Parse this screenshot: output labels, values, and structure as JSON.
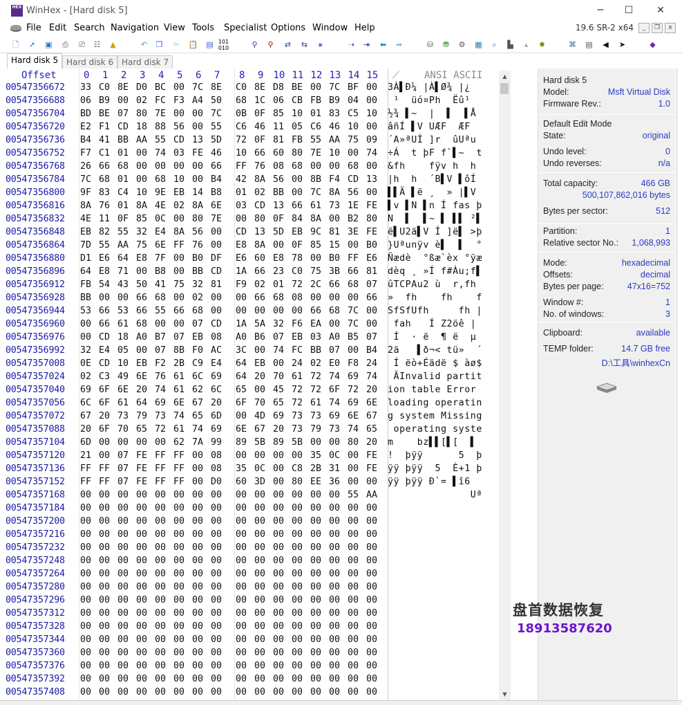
{
  "window": {
    "title": "WinHex - [Hard disk 5]",
    "app_icon_text": "HEX",
    "minimize": "─",
    "maximize": "☐",
    "close": "✕"
  },
  "menu": {
    "items": [
      "File",
      "Edit",
      "Search",
      "Navigation",
      "View",
      "Tools",
      "Specialist",
      "Options",
      "Window",
      "Help"
    ],
    "version": "19.6 SR-2 x64"
  },
  "tabs": [
    "Hard disk 5",
    "Hard disk 6",
    "Hard disk 7"
  ],
  "hex": {
    "offset_header": "Offset",
    "column_headers": [
      "0",
      "1",
      "2",
      "3",
      "4",
      "5",
      "6",
      "7",
      "8",
      "9",
      "10",
      "11",
      "12",
      "13",
      "14",
      "15"
    ],
    "ascii_header": "ANSI ASCII",
    "rows": [
      {
        "offset": "00547356672",
        "bytes": [
          "33",
          "C0",
          "8E",
          "D0",
          "BC",
          "00",
          "7C",
          "8E",
          "C0",
          "8E",
          "D8",
          "BE",
          "00",
          "7C",
          "BF",
          "00"
        ],
        "ascii": "3À▌Ð¼ |À▌Ø¾ |¿"
      },
      {
        "offset": "00547356688",
        "bytes": [
          "06",
          "B9",
          "00",
          "02",
          "FC",
          "F3",
          "A4",
          "50",
          "68",
          "1C",
          "06",
          "CB",
          "FB",
          "B9",
          "04",
          "00"
        ],
        "ascii": " ¹  üó¤Ph  Ëû¹"
      },
      {
        "offset": "00547356704",
        "bytes": [
          "BD",
          "BE",
          "07",
          "80",
          "7E",
          "00",
          "00",
          "7C",
          "0B",
          "0F",
          "85",
          "10",
          "01",
          "83",
          "C5",
          "10"
        ],
        "ascii": "½¾ ▌~  |  ▌  ▌Å"
      },
      {
        "offset": "00547356720",
        "bytes": [
          "E2",
          "F1",
          "CD",
          "18",
          "88",
          "56",
          "00",
          "55",
          "C6",
          "46",
          "11",
          "05",
          "C6",
          "46",
          "10",
          "00"
        ],
        "ascii": "âñÍ ▌V UÆF  ÆF"
      },
      {
        "offset": "00547356736",
        "bytes": [
          "B4",
          "41",
          "BB",
          "AA",
          "55",
          "CD",
          "13",
          "5D",
          "72",
          "0F",
          "81",
          "FB",
          "55",
          "AA",
          "75",
          "09"
        ],
        "ascii": "´A»ªUÍ ]r  ûUªu"
      },
      {
        "offset": "00547356752",
        "bytes": [
          "F7",
          "C1",
          "01",
          "00",
          "74",
          "03",
          "FE",
          "46",
          "10",
          "66",
          "60",
          "80",
          "7E",
          "10",
          "00",
          "74"
        ],
        "ascii": "÷Á  t þF f`▌~  t"
      },
      {
        "offset": "00547356768",
        "bytes": [
          "26",
          "66",
          "68",
          "00",
          "00",
          "00",
          "00",
          "66",
          "FF",
          "76",
          "08",
          "68",
          "00",
          "00",
          "68",
          "00"
        ],
        "ascii": "&fh    fÿv h  h"
      },
      {
        "offset": "00547356784",
        "bytes": [
          "7C",
          "68",
          "01",
          "00",
          "68",
          "10",
          "00",
          "B4",
          "42",
          "8A",
          "56",
          "00",
          "8B",
          "F4",
          "CD",
          "13"
        ],
        "ascii": "|h  h  ´B▌V ▌ôÍ"
      },
      {
        "offset": "00547356800",
        "bytes": [
          "9F",
          "83",
          "C4",
          "10",
          "9E",
          "EB",
          "14",
          "B8",
          "01",
          "02",
          "BB",
          "00",
          "7C",
          "8A",
          "56",
          "00"
        ],
        "ascii": "▌▌Ä ▌ë ¸  » |▌V"
      },
      {
        "offset": "00547356816",
        "bytes": [
          "8A",
          "76",
          "01",
          "8A",
          "4E",
          "02",
          "8A",
          "6E",
          "03",
          "CD",
          "13",
          "66",
          "61",
          "73",
          "1E",
          "FE"
        ],
        "ascii": "▌v ▌N ▌n Í fas þ"
      },
      {
        "offset": "00547356832",
        "bytes": [
          "4E",
          "11",
          "0F",
          "85",
          "0C",
          "00",
          "80",
          "7E",
          "00",
          "80",
          "0F",
          "84",
          "8A",
          "00",
          "B2",
          "80"
        ],
        "ascii": "N  ▌  ▌~ ▌ ▌▌ ²▌"
      },
      {
        "offset": "00547356848",
        "bytes": [
          "EB",
          "82",
          "55",
          "32",
          "E4",
          "8A",
          "56",
          "00",
          "CD",
          "13",
          "5D",
          "EB",
          "9C",
          "81",
          "3E",
          "FE"
        ],
        "ascii": "ë▌U2ä▌V Í ]ë▌ >þ"
      },
      {
        "offset": "00547356864",
        "bytes": [
          "7D",
          "55",
          "AA",
          "75",
          "6E",
          "FF",
          "76",
          "00",
          "E8",
          "8A",
          "00",
          "0F",
          "85",
          "15",
          "00",
          "B0"
        ],
        "ascii": "}Uªunÿv è▌  ▌  °"
      },
      {
        "offset": "00547356880",
        "bytes": [
          "D1",
          "E6",
          "64",
          "E8",
          "7F",
          "00",
          "B0",
          "DF",
          "E6",
          "60",
          "E8",
          "78",
          "00",
          "B0",
          "FF",
          "E6"
        ],
        "ascii": "Ñædè  °ßæ`èx °ÿæ"
      },
      {
        "offset": "00547356896",
        "bytes": [
          "64",
          "E8",
          "71",
          "00",
          "B8",
          "00",
          "BB",
          "CD",
          "1A",
          "66",
          "23",
          "C0",
          "75",
          "3B",
          "66",
          "81"
        ],
        "ascii": "dèq ¸ »Í f#Àu;f▌"
      },
      {
        "offset": "00547356912",
        "bytes": [
          "FB",
          "54",
          "43",
          "50",
          "41",
          "75",
          "32",
          "81",
          "F9",
          "02",
          "01",
          "72",
          "2C",
          "66",
          "68",
          "07"
        ],
        "ascii": "ûTCPAu2 ù  r,fh"
      },
      {
        "offset": "00547356928",
        "bytes": [
          "BB",
          "00",
          "00",
          "66",
          "68",
          "00",
          "02",
          "00",
          "00",
          "66",
          "68",
          "08",
          "00",
          "00",
          "00",
          "66"
        ],
        "ascii": "»  fh    fh    f"
      },
      {
        "offset": "00547356944",
        "bytes": [
          "53",
          "66",
          "53",
          "66",
          "55",
          "66",
          "68",
          "00",
          "00",
          "00",
          "00",
          "00",
          "66",
          "68",
          "7C",
          "00"
        ],
        "ascii": "SfSfUfh     fh |"
      },
      {
        "offset": "00547356960",
        "bytes": [
          "00",
          "66",
          "61",
          "68",
          "00",
          "00",
          "07",
          "CD",
          "1A",
          "5A",
          "32",
          "F6",
          "EA",
          "00",
          "7C",
          "00"
        ],
        "ascii": " fah   Í Z2öê |"
      },
      {
        "offset": "00547356976",
        "bytes": [
          "00",
          "CD",
          "18",
          "A0",
          "B7",
          "07",
          "EB",
          "08",
          "A0",
          "B6",
          "07",
          "EB",
          "03",
          "A0",
          "B5",
          "07"
        ],
        "ascii": " Í  · ë  ¶ ë  µ"
      },
      {
        "offset": "00547356992",
        "bytes": [
          "32",
          "E4",
          "05",
          "00",
          "07",
          "8B",
          "F0",
          "AC",
          "3C",
          "00",
          "74",
          "FC",
          "BB",
          "07",
          "00",
          "B4"
        ],
        "ascii": "2ä   ▌ð¬< tü»  ´"
      },
      {
        "offset": "00547357008",
        "bytes": [
          "0E",
          "CD",
          "10",
          "EB",
          "F2",
          "2B",
          "C9",
          "E4",
          "64",
          "EB",
          "00",
          "24",
          "02",
          "E0",
          "F8",
          "24"
        ],
        "ascii": " Í ëò+Éädë $ àø$"
      },
      {
        "offset": "00547357024",
        "bytes": [
          "02",
          "C3",
          "49",
          "6E",
          "76",
          "61",
          "6C",
          "69",
          "64",
          "20",
          "70",
          "61",
          "72",
          "74",
          "69",
          "74"
        ],
        "ascii": " ÃInvalid partit"
      },
      {
        "offset": "00547357040",
        "bytes": [
          "69",
          "6F",
          "6E",
          "20",
          "74",
          "61",
          "62",
          "6C",
          "65",
          "00",
          "45",
          "72",
          "72",
          "6F",
          "72",
          "20"
        ],
        "ascii": "ion table Error "
      },
      {
        "offset": "00547357056",
        "bytes": [
          "6C",
          "6F",
          "61",
          "64",
          "69",
          "6E",
          "67",
          "20",
          "6F",
          "70",
          "65",
          "72",
          "61",
          "74",
          "69",
          "6E"
        ],
        "ascii": "loading operatin"
      },
      {
        "offset": "00547357072",
        "bytes": [
          "67",
          "20",
          "73",
          "79",
          "73",
          "74",
          "65",
          "6D",
          "00",
          "4D",
          "69",
          "73",
          "73",
          "69",
          "6E",
          "67"
        ],
        "ascii": "g system Missing"
      },
      {
        "offset": "00547357088",
        "bytes": [
          "20",
          "6F",
          "70",
          "65",
          "72",
          "61",
          "74",
          "69",
          "6E",
          "67",
          "20",
          "73",
          "79",
          "73",
          "74",
          "65"
        ],
        "ascii": " operating syste"
      },
      {
        "offset": "00547357104",
        "bytes": [
          "6D",
          "00",
          "00",
          "00",
          "00",
          "62",
          "7A",
          "99",
          "89",
          "5B",
          "89",
          "5B",
          "00",
          "00",
          "80",
          "20"
        ],
        "ascii": "m    bz▌▌[▌[  ▌"
      },
      {
        "offset": "00547357120",
        "bytes": [
          "21",
          "00",
          "07",
          "FE",
          "FF",
          "FF",
          "00",
          "08",
          "00",
          "00",
          "00",
          "00",
          "35",
          "0C",
          "00",
          "FE"
        ],
        "ascii": "!  þÿÿ      5  þ"
      },
      {
        "offset": "00547357136",
        "bytes": [
          "FF",
          "FF",
          "07",
          "FE",
          "FF",
          "FF",
          "00",
          "08",
          "35",
          "0C",
          "00",
          "C8",
          "2B",
          "31",
          "00",
          "FE"
        ],
        "ascii": "ÿÿ þÿÿ  5  È+1 þ"
      },
      {
        "offset": "00547357152",
        "bytes": [
          "FF",
          "FF",
          "07",
          "FE",
          "FF",
          "FF",
          "00",
          "D0",
          "60",
          "3D",
          "00",
          "80",
          "EE",
          "36",
          "00",
          "00"
        ],
        "ascii": "ÿÿ þÿÿ Ð`= ▌î6"
      },
      {
        "offset": "00547357168",
        "bytes": [
          "00",
          "00",
          "00",
          "00",
          "00",
          "00",
          "00",
          "00",
          "00",
          "00",
          "00",
          "00",
          "00",
          "00",
          "55",
          "AA"
        ],
        "ascii": "              Uª"
      },
      {
        "offset": "00547357184",
        "bytes": [
          "00",
          "00",
          "00",
          "00",
          "00",
          "00",
          "00",
          "00",
          "00",
          "00",
          "00",
          "00",
          "00",
          "00",
          "00",
          "00"
        ],
        "ascii": ""
      },
      {
        "offset": "00547357200",
        "bytes": [
          "00",
          "00",
          "00",
          "00",
          "00",
          "00",
          "00",
          "00",
          "00",
          "00",
          "00",
          "00",
          "00",
          "00",
          "00",
          "00"
        ],
        "ascii": ""
      },
      {
        "offset": "00547357216",
        "bytes": [
          "00",
          "00",
          "00",
          "00",
          "00",
          "00",
          "00",
          "00",
          "00",
          "00",
          "00",
          "00",
          "00",
          "00",
          "00",
          "00"
        ],
        "ascii": ""
      },
      {
        "offset": "00547357232",
        "bytes": [
          "00",
          "00",
          "00",
          "00",
          "00",
          "00",
          "00",
          "00",
          "00",
          "00",
          "00",
          "00",
          "00",
          "00",
          "00",
          "00"
        ],
        "ascii": ""
      },
      {
        "offset": "00547357248",
        "bytes": [
          "00",
          "00",
          "00",
          "00",
          "00",
          "00",
          "00",
          "00",
          "00",
          "00",
          "00",
          "00",
          "00",
          "00",
          "00",
          "00"
        ],
        "ascii": ""
      },
      {
        "offset": "00547357264",
        "bytes": [
          "00",
          "00",
          "00",
          "00",
          "00",
          "00",
          "00",
          "00",
          "00",
          "00",
          "00",
          "00",
          "00",
          "00",
          "00",
          "00"
        ],
        "ascii": ""
      },
      {
        "offset": "00547357280",
        "bytes": [
          "00",
          "00",
          "00",
          "00",
          "00",
          "00",
          "00",
          "00",
          "00",
          "00",
          "00",
          "00",
          "00",
          "00",
          "00",
          "00"
        ],
        "ascii": ""
      },
      {
        "offset": "00547357296",
        "bytes": [
          "00",
          "00",
          "00",
          "00",
          "00",
          "00",
          "00",
          "00",
          "00",
          "00",
          "00",
          "00",
          "00",
          "00",
          "00",
          "00"
        ],
        "ascii": ""
      },
      {
        "offset": "00547357312",
        "bytes": [
          "00",
          "00",
          "00",
          "00",
          "00",
          "00",
          "00",
          "00",
          "00",
          "00",
          "00",
          "00",
          "00",
          "00",
          "00",
          "00"
        ],
        "ascii": ""
      },
      {
        "offset": "00547357328",
        "bytes": [
          "00",
          "00",
          "00",
          "00",
          "00",
          "00",
          "00",
          "00",
          "00",
          "00",
          "00",
          "00",
          "00",
          "00",
          "00",
          "00"
        ],
        "ascii": ""
      },
      {
        "offset": "00547357344",
        "bytes": [
          "00",
          "00",
          "00",
          "00",
          "00",
          "00",
          "00",
          "00",
          "00",
          "00",
          "00",
          "00",
          "00",
          "00",
          "00",
          "00"
        ],
        "ascii": ""
      },
      {
        "offset": "00547357360",
        "bytes": [
          "00",
          "00",
          "00",
          "00",
          "00",
          "00",
          "00",
          "00",
          "00",
          "00",
          "00",
          "00",
          "00",
          "00",
          "00",
          "00"
        ],
        "ascii": ""
      },
      {
        "offset": "00547357376",
        "bytes": [
          "00",
          "00",
          "00",
          "00",
          "00",
          "00",
          "00",
          "00",
          "00",
          "00",
          "00",
          "00",
          "00",
          "00",
          "00",
          "00"
        ],
        "ascii": ""
      },
      {
        "offset": "00547357392",
        "bytes": [
          "00",
          "00",
          "00",
          "00",
          "00",
          "00",
          "00",
          "00",
          "00",
          "00",
          "00",
          "00",
          "00",
          "00",
          "00",
          "00"
        ],
        "ascii": ""
      },
      {
        "offset": "00547357408",
        "bytes": [
          "00",
          "00",
          "00",
          "00",
          "00",
          "00",
          "00",
          "00",
          "00",
          "00",
          "00",
          "00",
          "00",
          "00",
          "00",
          "00"
        ],
        "ascii": ""
      }
    ]
  },
  "info": {
    "disk_name": "Hard disk 5",
    "model_label": "Model:",
    "model_value": "Msft Virtual Disk",
    "firmware_label": "Firmware Rev.:",
    "firmware_value": "1.0",
    "edit_mode": "Default Edit Mode",
    "state_label": "State:",
    "state_value": "original",
    "undo_level_label": "Undo level:",
    "undo_level_value": "0",
    "undo_reverses_label": "Undo reverses:",
    "undo_reverses_value": "n/a",
    "capacity_label": "Total capacity:",
    "capacity_value": "466 GB",
    "capacity_bytes": "500,107,862,016 bytes",
    "bps_label": "Bytes per sector:",
    "bps_value": "512",
    "partition_label": "Partition:",
    "partition_value": "1",
    "rel_sector_label": "Relative sector No.:",
    "rel_sector_value": "1,068,993",
    "mode_label": "Mode:",
    "mode_value": "hexadecimal",
    "offsets_label": "Offsets:",
    "offsets_value": "decimal",
    "bpp_label": "Bytes per page:",
    "bpp_value": "47x16=752",
    "window_no_label": "Window #:",
    "window_no_value": "1",
    "windows_label": "No. of windows:",
    "windows_value": "3",
    "clipboard_label": "Clipboard:",
    "clipboard_value": "available",
    "temp_label": "TEMP folder:",
    "temp_value": "14.7 GB free",
    "temp_path": "D:\\工具\\winhexCn"
  },
  "watermark": {
    "line1": "盘首数据恢复",
    "line2": "18913587620"
  }
}
